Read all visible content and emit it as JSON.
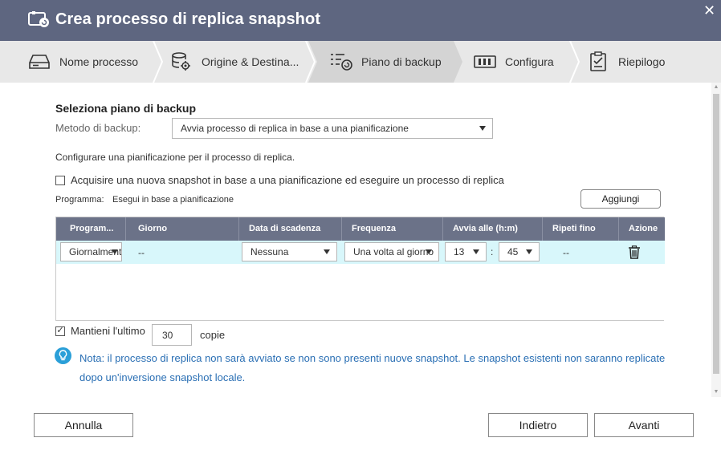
{
  "window": {
    "title": "Crea processo di replica snapshot",
    "close_glyph": "✕"
  },
  "steps": [
    {
      "label": "Nome processo",
      "icon": "drive-icon"
    },
    {
      "label": "Origine & Destina...",
      "icon": "gear-database-icon"
    },
    {
      "label": "Piano di backup",
      "icon": "schedule-list-icon",
      "active": true
    },
    {
      "label": "Configura",
      "icon": "configure-icon"
    },
    {
      "label": "Riepilogo",
      "icon": "clipboard-check-icon"
    }
  ],
  "section": {
    "title": "Seleziona piano di backup",
    "method_label": "Metodo di backup:",
    "method_value": "Avvia processo di replica in base a una pianificazione",
    "description": "Configurare una pianificazione per il processo di replica.",
    "snapshot_check_label": "Acquisire una nuova snapshot in base a una pianificazione ed eseguire un processo di replica",
    "snapshot_checked": false,
    "program_label": "Programma:",
    "program_value": "Esegui in base a pianificazione",
    "add_button": "Aggiungi"
  },
  "table": {
    "headers": [
      "Program...",
      "Giorno",
      "Data di scadenza",
      "Frequenza",
      "Avvia alle (h:m)",
      "Ripeti fino",
      "Azione"
    ],
    "rows": [
      {
        "program": "Giornalmente",
        "day": "--",
        "expiry": "Nessuna",
        "frequency": "Una volta al giorno",
        "hour": "13",
        "minute": "45",
        "repeat_until": "--"
      }
    ]
  },
  "retention": {
    "label": "Mantieni l'ultimo",
    "checked": true,
    "count": "30",
    "suffix": "copie"
  },
  "note": {
    "text": "Nota: il processo di replica non sarà avviato se non sono presenti nuove snapshot. Le snapshot esistenti non saranno replicate dopo un'inversione snapshot locale."
  },
  "footer": {
    "cancel": "Annulla",
    "back": "Indietro",
    "next": "Avanti"
  },
  "colors": {
    "titlebar": "#5e6680",
    "table_header": "#6b7288",
    "row_highlight": "#d8f7fb",
    "note_text": "#2a6fb4",
    "note_icon": "#2a9fd8"
  }
}
